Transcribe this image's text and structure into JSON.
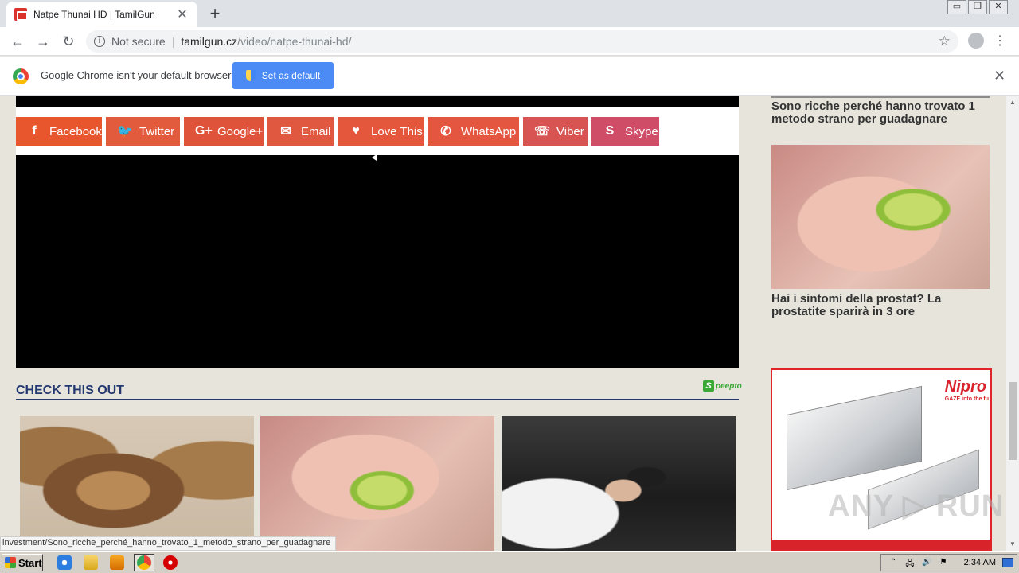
{
  "browser": {
    "tab_title": "Natpe Thunai HD | TamilGun",
    "tab_close": "✕",
    "new_tab": "+",
    "window_controls": [
      "▭",
      "❐",
      "✕"
    ],
    "nav": {
      "back": "←",
      "forward": "→",
      "reload": "↻"
    },
    "security_icon": "i",
    "security_text": "Not secure",
    "url_separator": "|",
    "url_host": "tamilgun.cz",
    "url_path": "/video/natpe-thunai-hd/",
    "bookmark_icon": "☆",
    "menu_icon": "⋮"
  },
  "infobar": {
    "message": "Google Chrome isn't your default browser",
    "button_label": "Set as default",
    "close": "✕"
  },
  "share_buttons": [
    {
      "label": "Facebook",
      "icon": "f",
      "color": "#e8562e"
    },
    {
      "label": "Twitter",
      "icon": "🐦",
      "color": "#e25b3c"
    },
    {
      "label": "Google+",
      "icon": "G+",
      "color": "#e0533b"
    },
    {
      "label": "Email",
      "icon": "✉",
      "color": "#e05840"
    },
    {
      "label": "Love This",
      "icon": "♥",
      "color": "#e5573c"
    },
    {
      "label": "WhatsApp",
      "icon": "✆",
      "color": "#e4563f"
    },
    {
      "label": "Viber",
      "icon": "☏",
      "color": "#d85452"
    },
    {
      "label": "Skype",
      "icon": "S",
      "color": "#cf4d66"
    }
  ],
  "section": {
    "title": "CHECK THIS OUT",
    "sponsor_logo": "S",
    "sponsor_text": "peepto"
  },
  "sidebar": {
    "caption_1": "Sono ricche perché hanno trovato 1 metodo strano per guadagnare",
    "caption_2": "Hai i sintomi della prostat? La prostatite sparirà in 3 ore",
    "ad_logo": "Nipro",
    "ad_tagline": "GAZE into the fu"
  },
  "watermark": "ANY ▷ RUN",
  "scrollbar": {
    "up": "▲",
    "down": "▼"
  },
  "status_url": "investment/Sono_ricche_perché_hanno_trovato_1_metodo_strano_per_guadagnare",
  "taskbar": {
    "start_label": "Start",
    "tray_icons": [
      "⌃",
      "🖧",
      "🔊",
      "⚑"
    ],
    "clock": "2:34 AM"
  }
}
